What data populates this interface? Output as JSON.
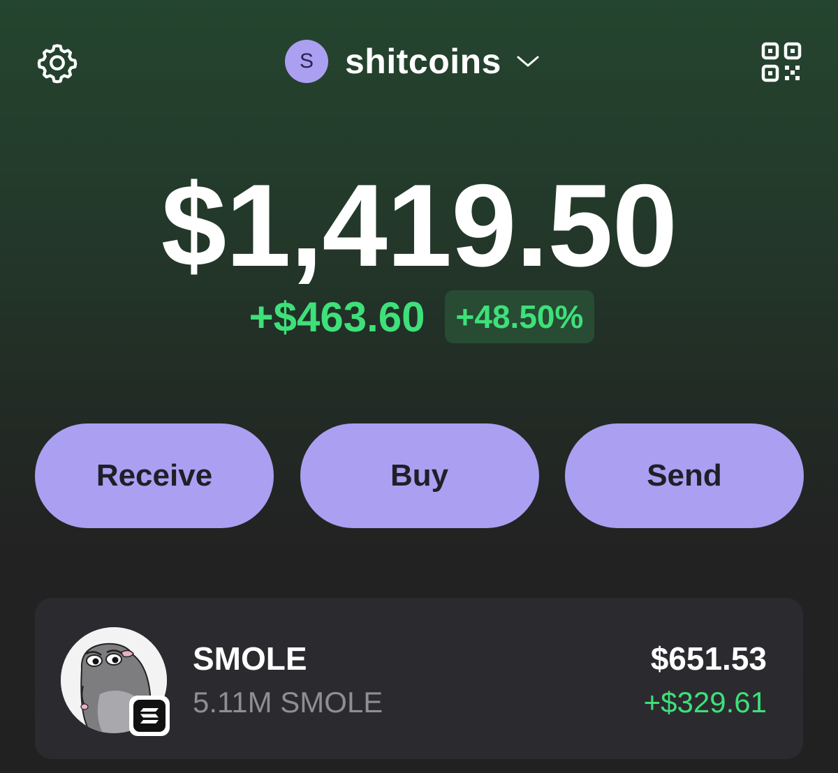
{
  "header": {
    "settings_icon": "gear-icon",
    "account": {
      "avatar_letter": "S",
      "name": "shitcoins",
      "chevron_icon": "chevron-down-icon"
    },
    "qr_icon": "qr-code-icon"
  },
  "balance": {
    "total": "$1,419.50",
    "change_amount": "+$463.60",
    "change_percent": "+48.50%"
  },
  "actions": {
    "receive_label": "Receive",
    "buy_label": "Buy",
    "send_label": "Send"
  },
  "tokens": [
    {
      "name": "SMOLE",
      "amount": "5.11M SMOLE",
      "value": "$651.53",
      "change": "+$329.61",
      "chain_icon": "solana-icon"
    }
  ],
  "colors": {
    "accent": "#ab9ff2",
    "positive": "#3ee07a",
    "card_bg": "#2b2b2f"
  }
}
